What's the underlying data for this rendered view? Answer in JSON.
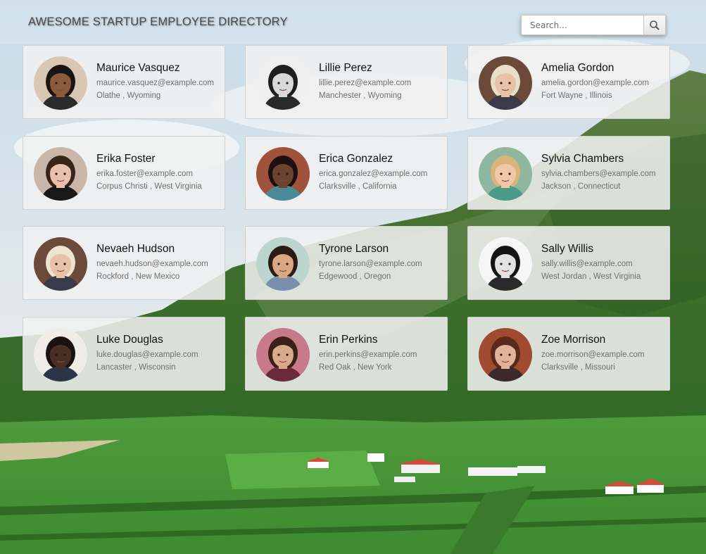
{
  "header": {
    "title": "AWESOME STARTUP EMPLOYEE DIRECTORY",
    "search_placeholder": "Search...",
    "search_icon": "magnifier-icon"
  },
  "colors": {
    "card_bg": "#f0f0f0",
    "name": "#111111",
    "detail": "#707070",
    "title": "#4a4a4a"
  },
  "employees": [
    {
      "name": "Maurice Vasquez",
      "email": "maurice.vasquez@example.com",
      "location": "Olathe , Wyoming",
      "photo": {
        "skin": "#8a5a3c",
        "hair": "#1a1412",
        "bg": "#d9c7b3",
        "shirt": "#2b2b2b"
      }
    },
    {
      "name": "Lillie Perez",
      "email": "lillie.perez@example.com",
      "location": "Manchester , Wyoming",
      "photo": {
        "skin": "#d8d8d8",
        "hair": "#1e1e1e",
        "bg": "#efefef",
        "shirt": "#2a2a2a"
      }
    },
    {
      "name": "Amelia Gordon",
      "email": "amelia.gordon@example.com",
      "location": "Fort Wayne , Illinois",
      "photo": {
        "skin": "#e8c2a8",
        "hair": "#e8dfc8",
        "bg": "#6b4a3a",
        "shirt": "#3a3a4a"
      }
    },
    {
      "name": "Erika Foster",
      "email": "erika.foster@example.com",
      "location": "Corpus Christi , West Virginia",
      "photo": {
        "skin": "#e9c0ab",
        "hair": "#3a2418",
        "bg": "#c9b6a9",
        "shirt": "#181818"
      }
    },
    {
      "name": "Erica Gonzalez",
      "email": "erica.gonzalez@example.com",
      "location": "Clarksville , California",
      "photo": {
        "skin": "#6b4330",
        "hair": "#1a1110",
        "bg": "#a0523a",
        "shirt": "#4a8a9a"
      }
    },
    {
      "name": "Sylvia Chambers",
      "email": "sylvia.chambers@example.com",
      "location": "Jackson , Connecticut",
      "photo": {
        "skin": "#f0c8a8",
        "hair": "#d9b57a",
        "bg": "#8fb7a0",
        "shirt": "#4a9a88"
      }
    },
    {
      "name": "Nevaeh Hudson",
      "email": "nevaeh.hudson@example.com",
      "location": "Rockford , New Mexico",
      "photo": {
        "skin": "#e8c2a8",
        "hair": "#ede4cf",
        "bg": "#6b4a3a",
        "shirt": "#3a3a4a"
      }
    },
    {
      "name": "Tyrone Larson",
      "email": "tyrone.larson@example.com",
      "location": "Edgewood , Oregon",
      "photo": {
        "skin": "#d9a883",
        "hair": "#2a1c14",
        "bg": "#bcd6cf",
        "shirt": "#7a8fb0"
      }
    },
    {
      "name": "Sally Willis",
      "email": "sally.willis@example.com",
      "location": "West Jordan , West Virginia",
      "photo": {
        "skin": "#e2e2e2",
        "hair": "#141414",
        "bg": "#f6f6f6",
        "shirt": "#2a2a2a"
      }
    },
    {
      "name": "Luke Douglas",
      "email": "luke.douglas@example.com",
      "location": "Lancaster , Wisconsin",
      "photo": {
        "skin": "#4a3024",
        "hair": "#1a1210",
        "bg": "#f0ede8",
        "shirt": "#2c3548"
      }
    },
    {
      "name": "Erin Perkins",
      "email": "erin.perkins@example.com",
      "location": "Red Oak , New York",
      "photo": {
        "skin": "#d9a98c",
        "hair": "#3a2016",
        "bg": "#c77a8a",
        "shirt": "#6a2a3a"
      }
    },
    {
      "name": "Zoe Morrison",
      "email": "zoe.morrison@example.com",
      "location": "Clarksville , Missouri",
      "photo": {
        "skin": "#e2b39a",
        "hair": "#5a2a1a",
        "bg": "#a04a30",
        "shirt": "#3a2a2a"
      }
    }
  ]
}
